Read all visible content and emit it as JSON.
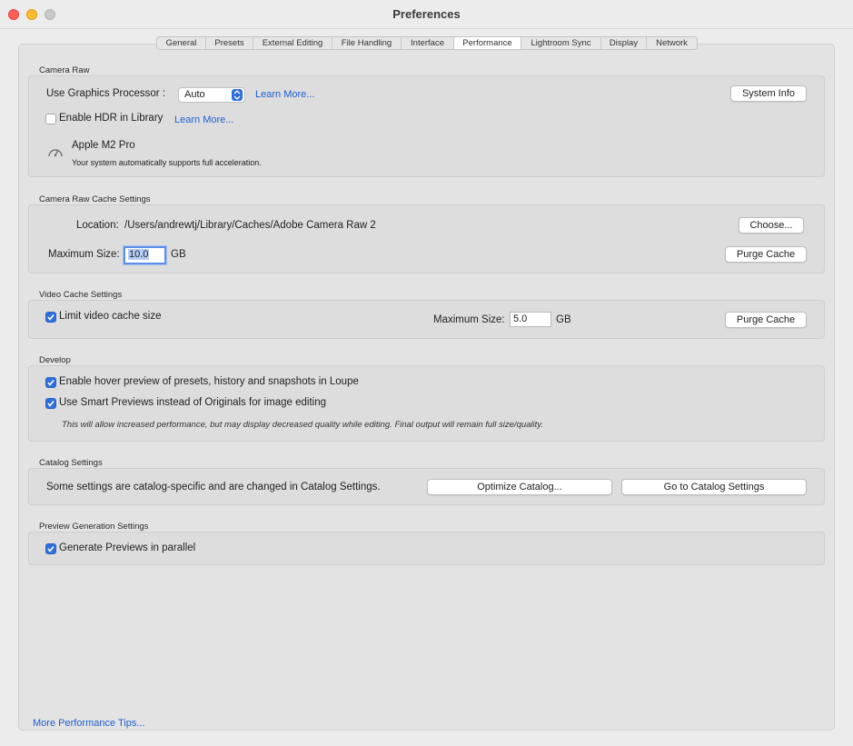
{
  "window": {
    "title": "Preferences"
  },
  "tabs": [
    {
      "label": "General",
      "active": false
    },
    {
      "label": "Presets",
      "active": false
    },
    {
      "label": "External Editing",
      "active": false
    },
    {
      "label": "File Handling",
      "active": false
    },
    {
      "label": "Interface",
      "active": false
    },
    {
      "label": "Performance",
      "active": true
    },
    {
      "label": "Lightroom Sync",
      "active": false
    },
    {
      "label": "Display",
      "active": false
    },
    {
      "label": "Network",
      "active": false
    }
  ],
  "camera_raw": {
    "heading": "Camera Raw",
    "gpu_label": "Use Graphics Processor :",
    "gpu_value": "Auto",
    "gpu_learn_more": "Learn More...",
    "system_info_button": "System Info",
    "hdr_label": "Enable HDR in Library",
    "hdr_checked": false,
    "hdr_learn_more": "Learn More...",
    "gpu_name": "Apple M2 Pro",
    "gpu_note": "Your system automatically supports full acceleration."
  },
  "cache": {
    "heading": "Camera Raw Cache Settings",
    "location_label": "Location:",
    "location_value": "/Users/andrewtj/Library/Caches/Adobe Camera Raw 2",
    "choose_button": "Choose...",
    "max_size_label": "Maximum Size:",
    "max_size_value": "10.0",
    "unit": "GB",
    "purge_button": "Purge Cache"
  },
  "video_cache": {
    "heading": "Video Cache Settings",
    "limit_label": "Limit video cache size",
    "limit_checked": true,
    "max_size_label": "Maximum Size:",
    "max_size_value": "5.0",
    "unit": "GB",
    "purge_button": "Purge Cache"
  },
  "develop": {
    "heading": "Develop",
    "hover_label": "Enable hover preview of presets, history and snapshots in Loupe",
    "hover_checked": true,
    "smart_label": "Use Smart Previews instead of Originals for image editing",
    "smart_checked": true,
    "note": "This will allow increased performance, but may display decreased quality while editing. Final output will remain full size/quality."
  },
  "catalog": {
    "heading": "Catalog Settings",
    "text": "Some settings are catalog-specific and are changed in Catalog Settings.",
    "optimize_button": "Optimize Catalog...",
    "goto_button": "Go to Catalog Settings"
  },
  "preview_gen": {
    "heading": "Preview Generation Settings",
    "parallel_label": "Generate Previews in parallel",
    "parallel_checked": true
  },
  "footer": {
    "tips_link": "More Performance Tips..."
  },
  "colors": {
    "accent": "#2f6fdc",
    "link": "#1f5fd1"
  }
}
